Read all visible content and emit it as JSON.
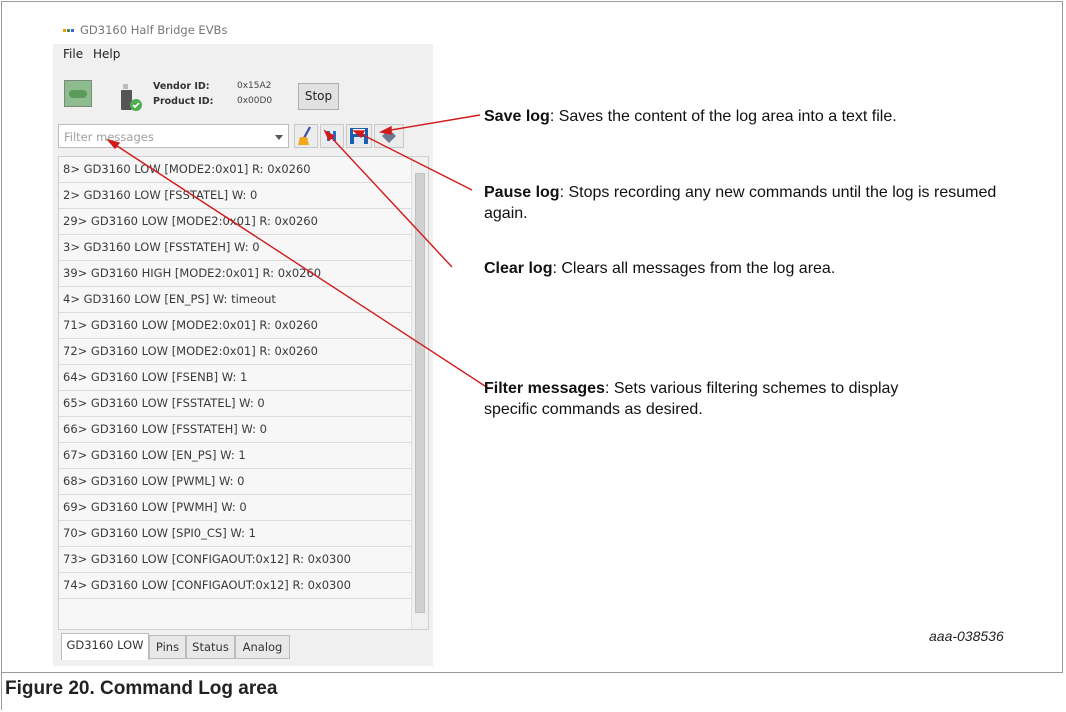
{
  "window": {
    "title": "GD3160 Half Bridge EVBs"
  },
  "menu": {
    "items": [
      "File",
      "Help"
    ]
  },
  "device": {
    "vendor_label": "Vendor ID:",
    "vendor_value": "0x15A2",
    "product_label": "Product ID:",
    "product_value": "0x00D0",
    "stop_label": "Stop"
  },
  "filter": {
    "placeholder": "Filter messages"
  },
  "toolbar": {
    "clear_icon": "broom-icon",
    "pause_icon": "pause-icon",
    "save_icon": "floppy-disk-icon",
    "other_icon": "diamond-icon"
  },
  "log": {
    "rows": [
      "8> GD3160 LOW [MODE2:0x01] R: 0x0260",
      "2> GD3160 LOW [FSSTATEL] W: 0",
      "29> GD3160 LOW [MODE2:0x01] R: 0x0260",
      "3> GD3160 LOW [FSSTATEH] W: 0",
      "39> GD3160 HIGH [MODE2:0x01] R: 0x0260",
      "4> GD3160 LOW [EN_PS] W: timeout",
      "71> GD3160 LOW [MODE2:0x01] R: 0x0260",
      "72> GD3160 LOW [MODE2:0x01] R: 0x0260",
      "64> GD3160 LOW [FSENB] W: 1",
      "65> GD3160 LOW [FSSTATEL] W: 0",
      "66> GD3160 LOW [FSSTATEH] W: 0",
      "67> GD3160 LOW [EN_PS] W: 1",
      "68> GD3160 LOW [PWML] W: 0",
      "69> GD3160 LOW [PWMH] W: 0",
      "70> GD3160 LOW [SPI0_CS] W: 1",
      "73> GD3160 LOW [CONFIGAOUT:0x12] R: 0x0300",
      "74> GD3160 LOW [CONFIGAOUT:0x12] R: 0x0300"
    ]
  },
  "tabs": [
    "GD3160 LOW",
    "Pins",
    "Status",
    "Analog"
  ],
  "callouts": {
    "save": {
      "term": "Save log",
      "text": ": Saves the content of the log area into a text file."
    },
    "pause": {
      "term": "Pause log",
      "text": ": Stops recording any new commands until the log is resumed again."
    },
    "clear": {
      "term": "Clear log",
      "text": ": Clears all messages from the log area."
    },
    "filter": {
      "term": "Filter messages",
      "text": ": Sets various filtering schemes to display specific commands as desired."
    }
  },
  "figure": {
    "id": "aaa-038536",
    "caption": "Figure 20.  Command Log area"
  },
  "colors": {
    "leader_line": "#d11a1a",
    "pause_blue": "#1a6fd1",
    "toggle_green": "#5a9a5a"
  }
}
